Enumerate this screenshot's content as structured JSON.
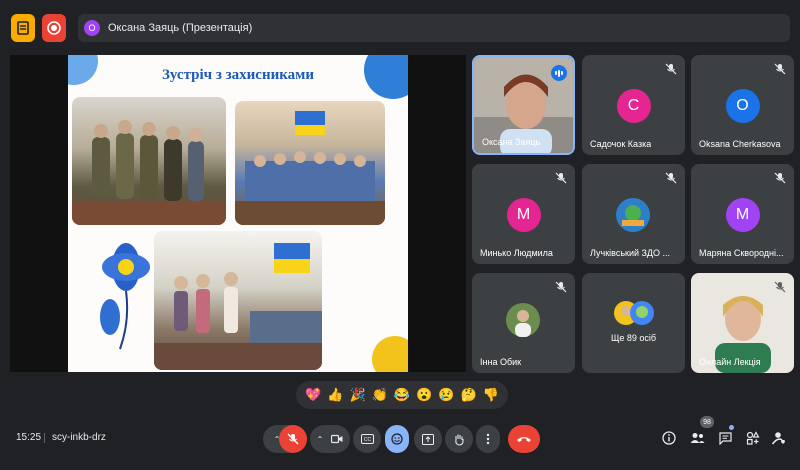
{
  "header": {
    "presenting_initial": "О",
    "presenting_text": "Оксана Заяць (Презентація)"
  },
  "slide": {
    "title": "Зустріч з захисниками"
  },
  "participants": [
    {
      "name": "Оксана Заяць",
      "type": "video",
      "speaking": true
    },
    {
      "name": "Садочок Казка",
      "initial": "С",
      "color": "#e52592",
      "muted": true
    },
    {
      "name": "Oksana Cherkasova",
      "initial": "O",
      "color": "#1a73e8",
      "muted": true
    },
    {
      "name": "Минько Людмила",
      "initial": "М",
      "color": "#e52592",
      "muted": true
    },
    {
      "name": "Лучківський ЗДО ...",
      "type": "image",
      "muted": true
    },
    {
      "name": "Маряна Сквородні...",
      "initial": "М",
      "color": "#a142f4",
      "muted": true
    },
    {
      "name": "Інна Обик",
      "type": "image",
      "muted": true
    },
    {
      "name": "Ще 89 осіб",
      "type": "group"
    },
    {
      "name": "Онлайн Лекція",
      "type": "video",
      "muted": true
    }
  ],
  "reactions": [
    "💖",
    "👍",
    "🎉",
    "👏",
    "😂",
    "😮",
    "😢",
    "🤔",
    "👎"
  ],
  "footer": {
    "time": "15:25",
    "meeting_code": "scy-inkb-drz",
    "participants_badge": "98"
  },
  "colors": {
    "background": "#202124",
    "tile": "#3c4043",
    "accent_blue": "#8ab4f8",
    "danger_red": "#ea4335"
  },
  "icons": [
    "files-icon",
    "record-icon",
    "mic-off-icon",
    "camera-icon",
    "captions-icon",
    "emoji-icon",
    "present-icon",
    "raise-hand-icon",
    "more-icon",
    "end-call-icon",
    "info-icon",
    "people-icon",
    "chat-icon",
    "activities-icon",
    "host-controls-icon"
  ]
}
